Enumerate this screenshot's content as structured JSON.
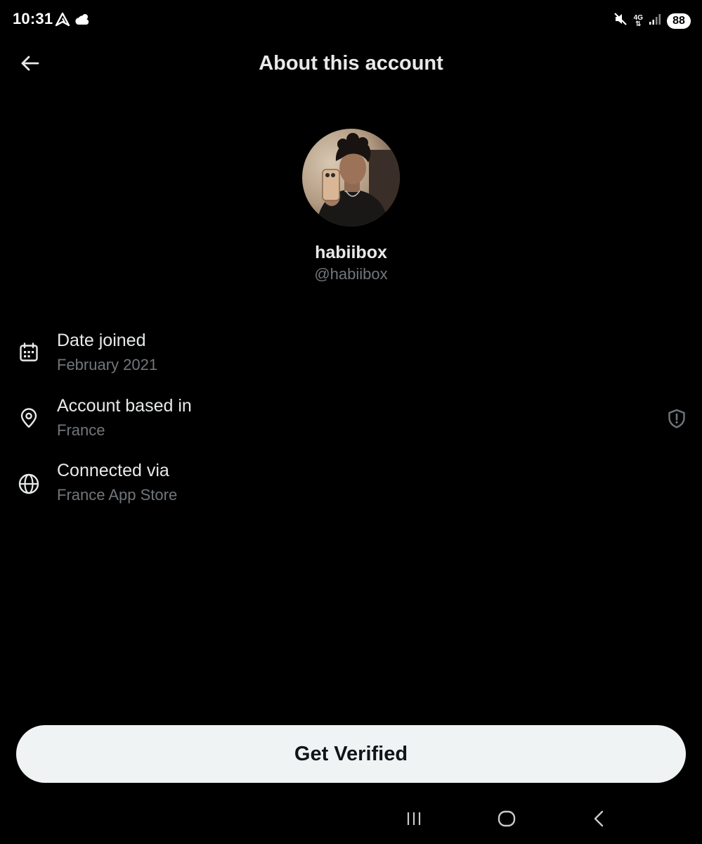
{
  "status_bar": {
    "time": "10:31",
    "battery": "88",
    "network": "4G",
    "left_icons": [
      "navigation-app-icon",
      "weather-cloud-icon"
    ],
    "right_icons": [
      "mute-icon",
      "mobile-data-icon",
      "signal-icon",
      "battery-icon"
    ]
  },
  "header": {
    "title": "About this account",
    "back_icon": "arrow-left-icon"
  },
  "profile": {
    "display_name": "habiibox",
    "handle": "@habiibox"
  },
  "info": {
    "date_joined": {
      "label": "Date joined",
      "value": "February 2021",
      "icon": "calendar-icon"
    },
    "account_based_in": {
      "label": "Account based in",
      "value": "France",
      "icon": "location-pin-icon",
      "trailing_icon": "shield-alert-icon"
    },
    "connected_via": {
      "label": "Connected via",
      "value": "France App Store",
      "icon": "globe-icon"
    }
  },
  "cta": {
    "label": "Get Verified"
  },
  "nav_bar": {
    "icons": [
      "recent-apps-icon",
      "home-icon",
      "back-icon"
    ]
  },
  "colors": {
    "background": "#000000",
    "primary_text": "#e7e9ea",
    "secondary_text": "#71767b",
    "button_bg": "#eff3f4",
    "button_text": "#0f1419"
  }
}
